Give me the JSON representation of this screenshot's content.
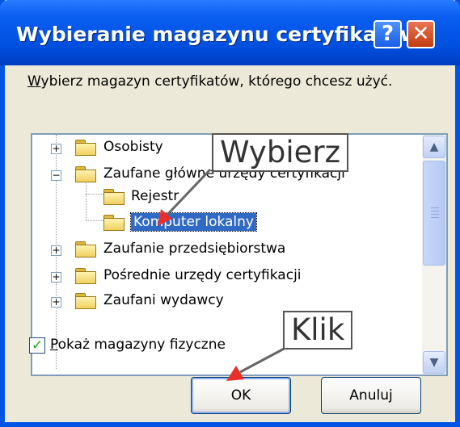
{
  "dialog": {
    "title": "Wybieranie magazynu certyfikatów",
    "help_glyph": "?",
    "close_glyph": "✕",
    "instruction_hotkey": "W",
    "instruction_rest": "ybierz magazyn certyfikatów, którego chcesz użyć."
  },
  "tree": {
    "items": [
      {
        "label": "Osobisty",
        "expander": "+"
      },
      {
        "label": "Zaufane główne urzędy certyfikacji",
        "expander": "−"
      },
      {
        "label": "Rejestr"
      },
      {
        "label": "Komputer lokalny",
        "selected": true
      },
      {
        "label": "Zaufanie przedsiębiorstwa",
        "expander": "+"
      },
      {
        "label": "Pośrednie urzędy certyfikacji",
        "expander": "+"
      },
      {
        "label": "Zaufani wydawcy",
        "expander": "+"
      }
    ],
    "scroll_up_glyph": "▲",
    "scroll_down_glyph": "▼"
  },
  "annotations": {
    "choose": "Wybierz",
    "click": "Klik"
  },
  "checkbox": {
    "checked": true,
    "mark": "✓",
    "hotkey": "P",
    "label_rest": "okaż magazyny fizyczne"
  },
  "buttons": {
    "ok": "OK",
    "cancel": "Anuluj"
  },
  "colors": {
    "titlebar": "#0054e3",
    "selection": "#316ac5",
    "arrow": "#e8312a",
    "dialog_bg": "#ece9d8"
  }
}
